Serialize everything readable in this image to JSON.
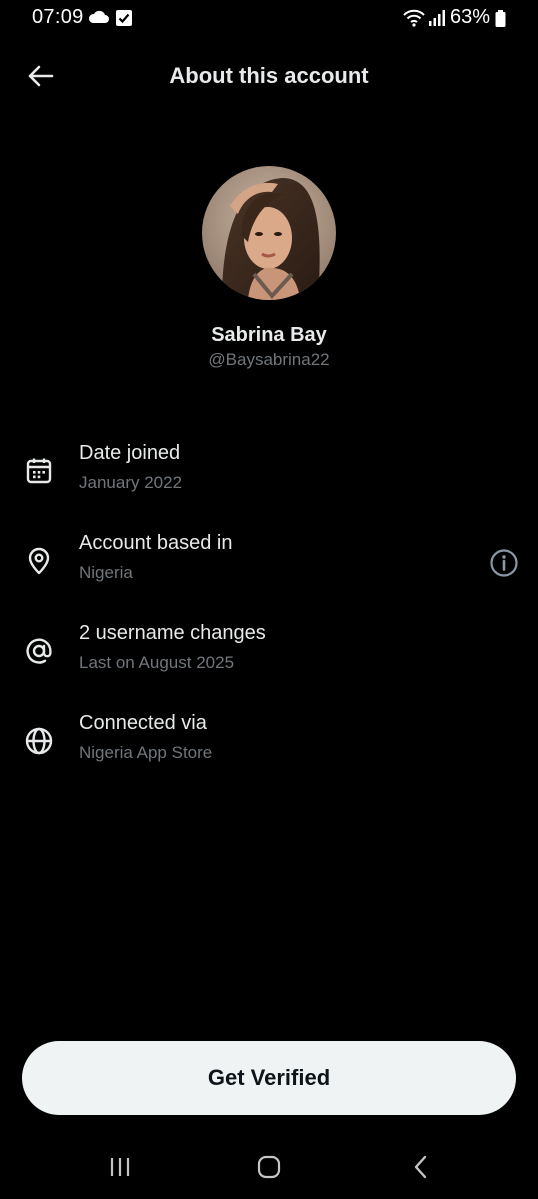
{
  "status_bar": {
    "time": "07:09",
    "battery": "63%"
  },
  "header": {
    "title": "About this account"
  },
  "profile": {
    "name": "Sabrina Bay",
    "handle": "@Baysabrina22"
  },
  "info_rows": [
    {
      "icon": "calendar-icon",
      "title": "Date joined",
      "subtitle": "January 2022"
    },
    {
      "icon": "location-pin-icon",
      "title": "Account based in",
      "subtitle": "Nigeria"
    },
    {
      "icon": "at-sign-icon",
      "title": "2 username changes",
      "subtitle": "Last on August 2025"
    },
    {
      "icon": "globe-icon",
      "title": "Connected via",
      "subtitle": "Nigeria App Store"
    }
  ],
  "cta": {
    "label": "Get Verified"
  },
  "colors": {
    "background": "#000000",
    "primary_text": "#e7e9ea",
    "secondary_text": "#71767b",
    "button_bg": "#eff3f4",
    "button_text": "#0f1419"
  }
}
